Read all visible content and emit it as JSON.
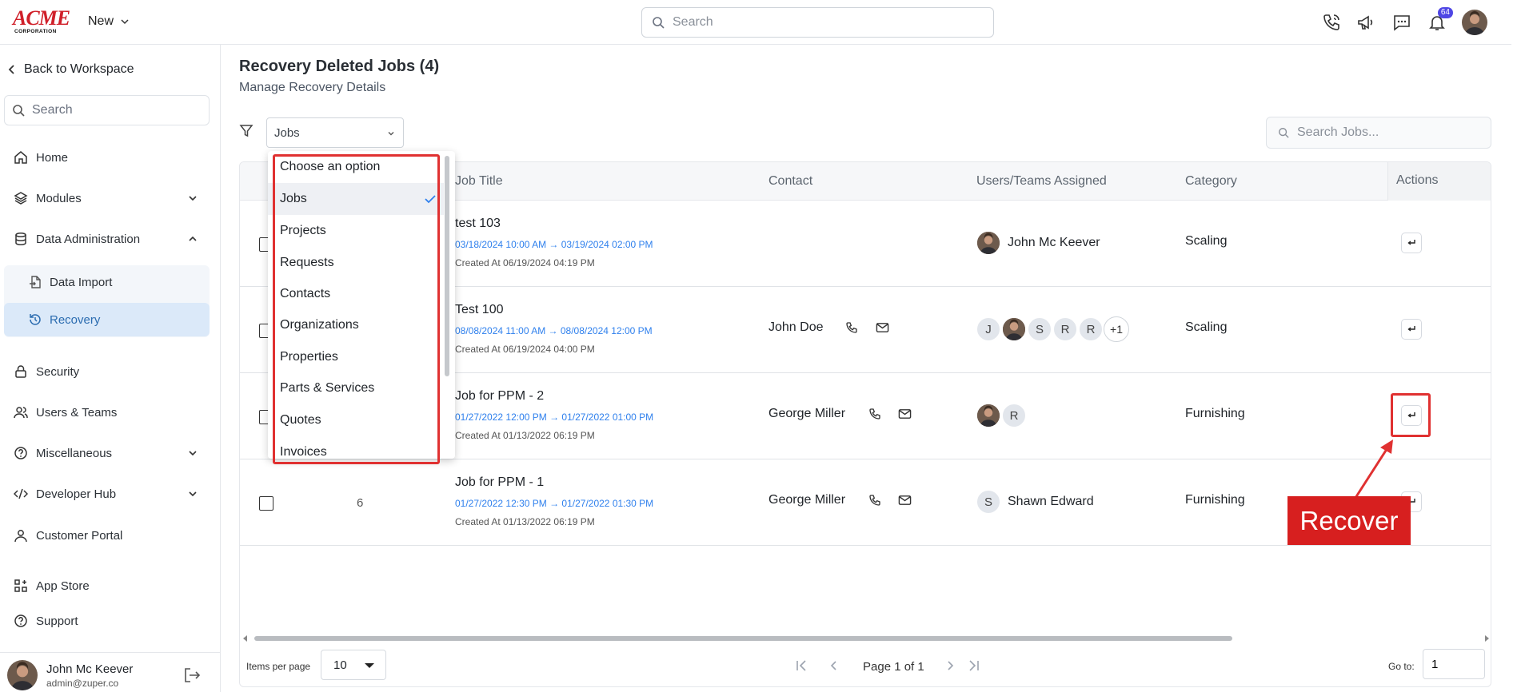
{
  "brand": {
    "logo_top": "ACME",
    "logo_bottom": "CORPORATION",
    "accent": "#d0202a"
  },
  "topbar": {
    "new_label": "New",
    "search_placeholder": "Search",
    "notification_count": "64",
    "icons": [
      "phone-icon",
      "megaphone-icon",
      "chat-icon",
      "bell-icon"
    ]
  },
  "sidebar": {
    "back_label": "Back to Workspace",
    "search_placeholder": "Search",
    "items": {
      "home": "Home",
      "modules": "Modules",
      "data_admin": "Data Administration",
      "data_import": "Data Import",
      "recovery": "Recovery",
      "security": "Security",
      "users_teams": "Users & Teams",
      "misc": "Miscellaneous",
      "dev_hub": "Developer Hub",
      "customer_portal": "Customer Portal",
      "app_store": "App Store",
      "support": "Support"
    },
    "user": {
      "name": "John Mc Keever",
      "email": "admin@zuper.co"
    }
  },
  "main": {
    "title": "Recovery Deleted Jobs (4)",
    "subtitle": "Manage Recovery Details",
    "type_select_value": "Jobs",
    "jobs_search_placeholder": "Search Jobs...",
    "columns": {
      "job_title": "Job Title",
      "contact": "Contact",
      "assigned": "Users/Teams Assigned",
      "category": "Category",
      "actions": "Actions"
    },
    "rows": [
      {
        "id": "",
        "title": "test 103",
        "dates": "03/18/2024 10:00 AM → 03/19/2024 02:00 PM",
        "created": "Created At 06/19/2024 04:19 PM",
        "contact": "",
        "assigned_name": "John Mc Keever",
        "category": "Scaling"
      },
      {
        "id": "",
        "title": "Test 100",
        "dates": "08/08/2024 11:00 AM → 08/08/2024 12:00 PM",
        "created": "Created At 06/19/2024 04:00 PM",
        "contact": "John Doe",
        "initials": [
          "J",
          "S",
          "R",
          "R"
        ],
        "more": "+1",
        "category": "Scaling"
      },
      {
        "id": "",
        "title": "Job for PPM - 2",
        "dates": "01/27/2022 12:00 PM → 01/27/2022 01:00 PM",
        "created": "Created At 01/13/2022 06:19 PM",
        "contact": "George Miller",
        "initial": "R",
        "category": "Furnishing"
      },
      {
        "id": "6",
        "title": "Job for PPM - 1",
        "dates": "01/27/2022 12:30 PM → 01/27/2022 01:30 PM",
        "created": "Created At 01/13/2022 06:19 PM",
        "contact": "George Miller",
        "initial": "S",
        "assigned_name": "Shawn Edward",
        "category": "Furnishing"
      }
    ],
    "pagination": {
      "items_per_page_label": "Items per page",
      "items_per_page": "10",
      "page_label": "Page 1 of 1",
      "goto_label": "Go to:",
      "goto_value": "1"
    }
  },
  "dropdown": {
    "options": [
      "Choose an option",
      "Jobs",
      "Projects",
      "Requests",
      "Contacts",
      "Organizations",
      "Properties",
      "Parts & Services",
      "Quotes",
      "Invoices"
    ],
    "selected": "Jobs"
  },
  "annotation": {
    "callout": "Recover",
    "color": "#e03131"
  }
}
